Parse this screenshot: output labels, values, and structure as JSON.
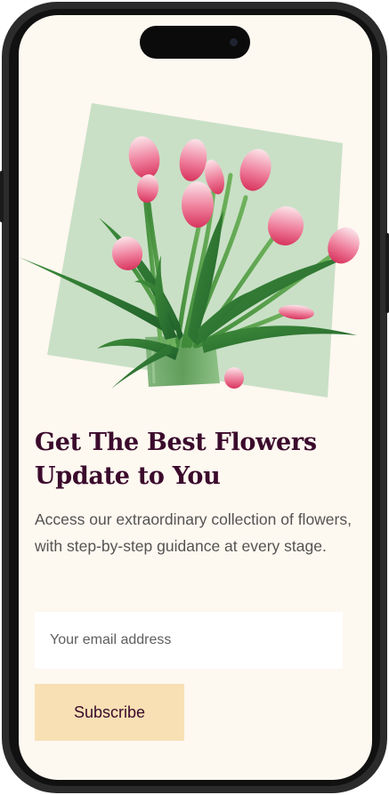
{
  "hero": {
    "title": "Get The Best Flowers Update to You",
    "description": "Access our extraordinary collection of flowers, with step-by-step guidance at every stage."
  },
  "form": {
    "email_placeholder": "Your email address",
    "subscribe_label": "Subscribe"
  },
  "colors": {
    "background": "#fdf8f0",
    "title": "#3b0a2c",
    "body_text": "#555352",
    "button_bg": "#f8e0b4",
    "image_panel": "#c9e0c6"
  }
}
